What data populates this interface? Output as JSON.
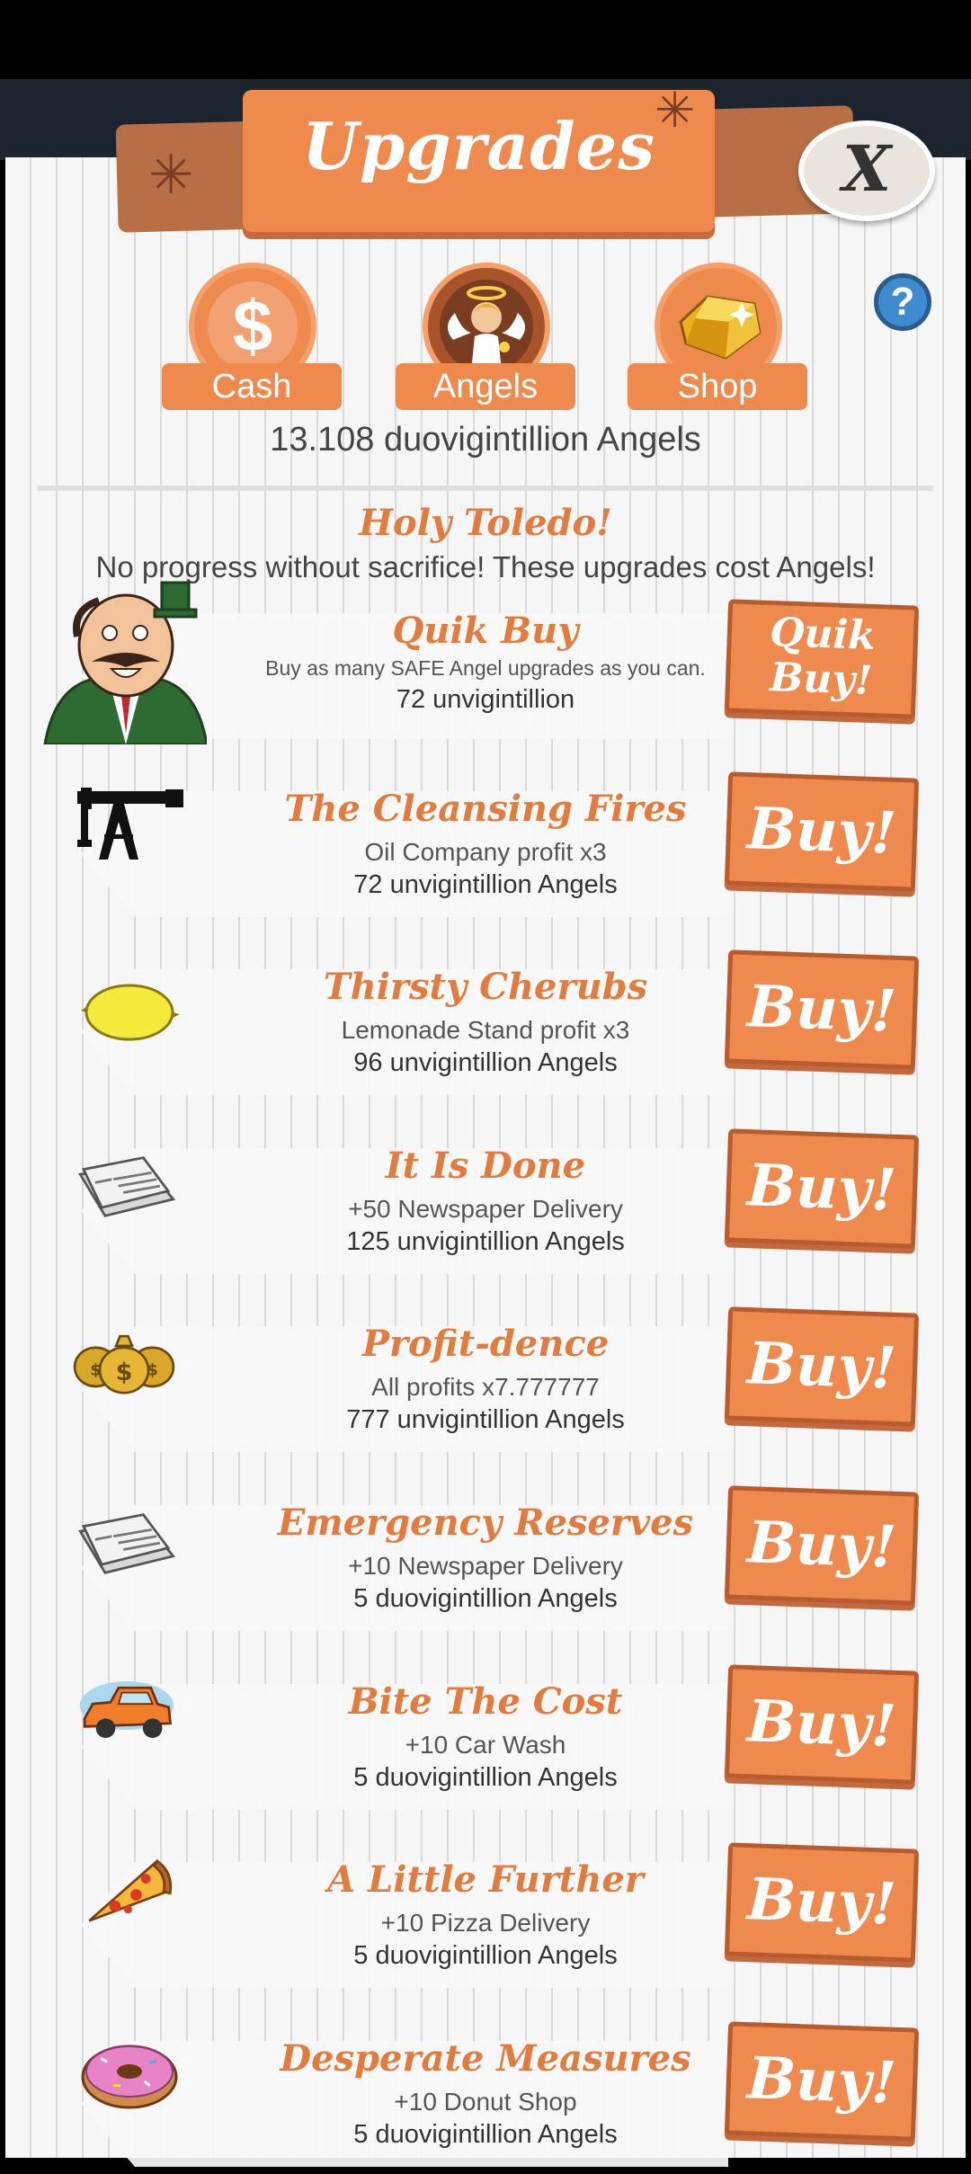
{
  "header": {
    "title": "Upgrades",
    "close_label": "X"
  },
  "tabs": [
    {
      "label": "Cash",
      "icon": "dollar-icon"
    },
    {
      "label": "Angels",
      "icon": "angel-icon"
    },
    {
      "label": "Shop",
      "icon": "gold-gem-icon"
    }
  ],
  "help_label": "?",
  "angel_count": "13.108 duovigintillion Angels",
  "subtitle": "Holy Toledo!",
  "notice": "No progress without sacrifice! These upgrades cost Angels!",
  "quik_buy": {
    "title": "Quik Buy",
    "desc": "Buy as many SAFE Angel upgrades as you can.",
    "cost": "72 unvigintillion",
    "button": "Quik Buy!"
  },
  "upgrades": [
    {
      "title": "The Cleansing Fires",
      "desc": "Oil Company profit x3",
      "cost": "72 unvigintillion Angels",
      "icon": "oil-derrick-icon",
      "button": "Buy!"
    },
    {
      "title": "Thirsty Cherubs",
      "desc": "Lemonade Stand profit x3",
      "cost": "96 unvigintillion Angels",
      "icon": "lemon-icon",
      "button": "Buy!"
    },
    {
      "title": "It Is Done",
      "desc": "+50 Newspaper Delivery",
      "cost": "125 unvigintillion Angels",
      "icon": "newspaper-icon",
      "button": "Buy!"
    },
    {
      "title": "Profit-dence",
      "desc": "All profits x7.777777",
      "cost": "777 unvigintillion Angels",
      "icon": "money-bags-icon",
      "button": "Buy!"
    },
    {
      "title": "Emergency Reserves",
      "desc": "+10 Newspaper Delivery",
      "cost": "5 duovigintillion Angels",
      "icon": "newspaper-icon",
      "button": "Buy!"
    },
    {
      "title": "Bite The Cost",
      "desc": "+10 Car Wash",
      "cost": "5 duovigintillion Angels",
      "icon": "car-icon",
      "button": "Buy!"
    },
    {
      "title": "A Little Further",
      "desc": "+10 Pizza Delivery",
      "cost": "5 duovigintillion Angels",
      "icon": "pizza-slice-icon",
      "button": "Buy!"
    },
    {
      "title": "Desperate Measures",
      "desc": "+10 Donut Shop",
      "cost": "5 duovigintillion Angels",
      "icon": "donut-icon",
      "button": "Buy!"
    }
  ]
}
